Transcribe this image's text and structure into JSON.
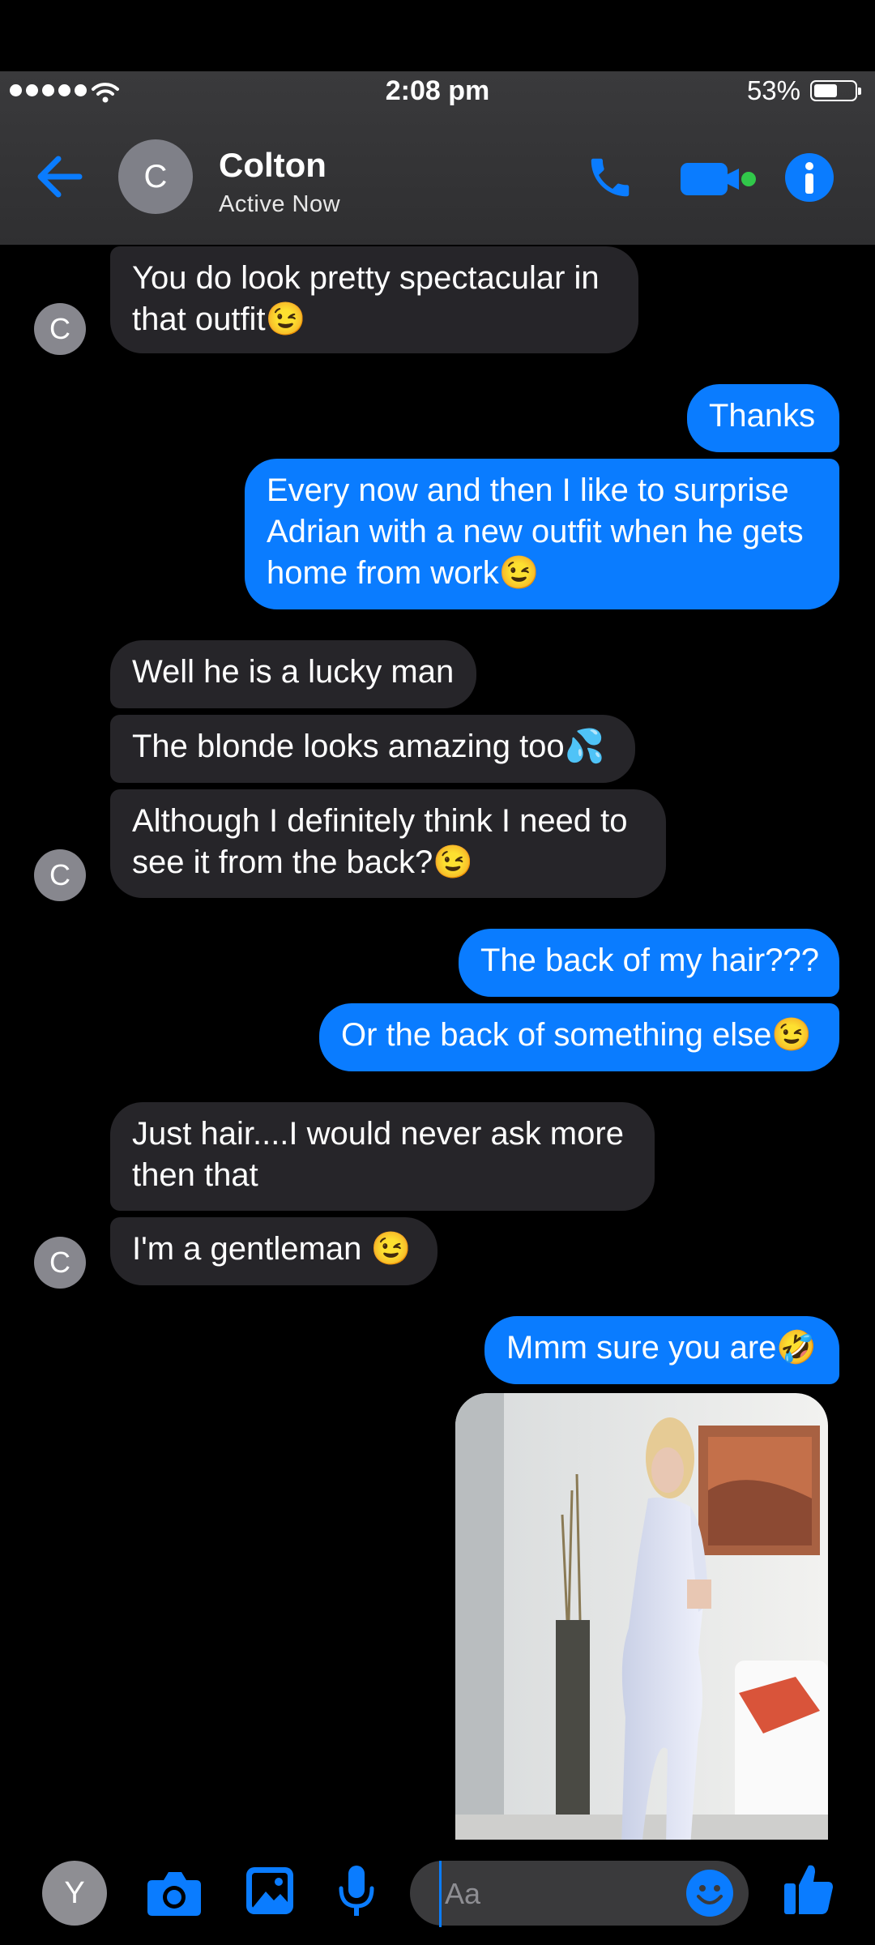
{
  "status_bar": {
    "time": "2:08 pm",
    "battery": "53%",
    "battery_level": 0.53
  },
  "header": {
    "avatar_initial": "C",
    "name": "Colton",
    "status": "Active Now"
  },
  "messages": [
    {
      "from": "them",
      "text": "You do look pretty spectacular in that outfit😉"
    },
    {
      "from": "me",
      "text": "Thanks"
    },
    {
      "from": "me",
      "text": "Every now and then I like to surprise Adrian with a new outfit when he gets home from work😉"
    },
    {
      "from": "them",
      "text": "Well he is a lucky man"
    },
    {
      "from": "them",
      "text": "The blonde looks amazing too💦"
    },
    {
      "from": "them",
      "text": "Although I definitely think I need to see it from the back?😉"
    },
    {
      "from": "me",
      "text": "The back of my hair???"
    },
    {
      "from": "me",
      "text": "Or the back of something else😉"
    },
    {
      "from": "them",
      "text": "Just hair....I would never ask more then that"
    },
    {
      "from": "them",
      "text": "I'm a gentleman 😉"
    },
    {
      "from": "me",
      "text": "Mmm sure you are🤣"
    }
  ],
  "contact_avatar_initial": "C",
  "composer": {
    "user_avatar_initial": "Y",
    "placeholder": "Aa"
  },
  "colors": {
    "accent": "#0a7cff",
    "incoming_bubble": "#262529",
    "outgoing_bubble": "#0a7cff",
    "header_bg": "#3a3a3c"
  }
}
